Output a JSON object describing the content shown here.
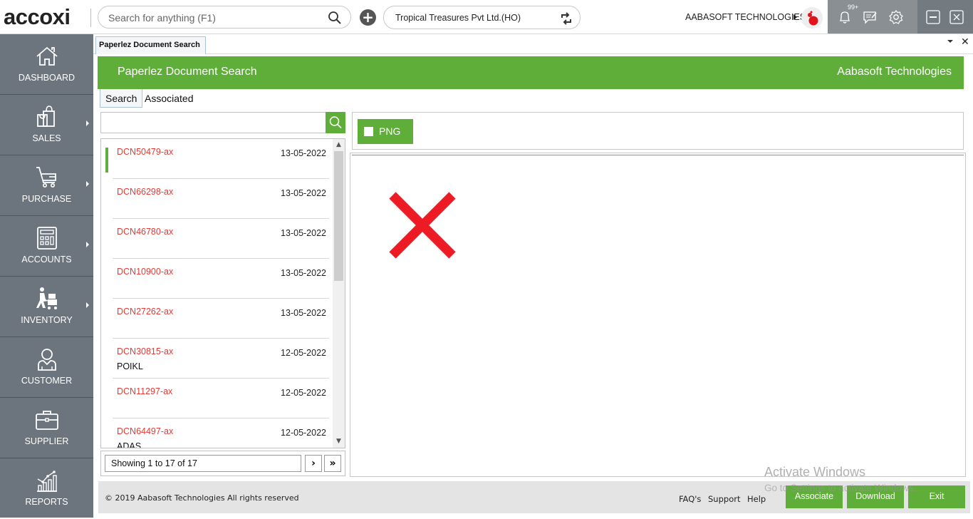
{
  "app": {
    "logo": "accoxi",
    "search_placeholder": "Search for anything (F1)",
    "company": "Tropical Treasures Pvt Ltd.(HO)",
    "organization": "AABASOFT TECHNOLOGIES",
    "notification_count": "99+"
  },
  "sidebar": {
    "items": [
      {
        "label": "DASHBOARD",
        "icon": "home-icon",
        "has_submenu": false
      },
      {
        "label": "SALES",
        "icon": "shopping-bag-icon",
        "has_submenu": true
      },
      {
        "label": "PURCHASE",
        "icon": "cart-icon",
        "has_submenu": true
      },
      {
        "label": "ACCOUNTS",
        "icon": "calculator-icon",
        "has_submenu": true
      },
      {
        "label": "INVENTORY",
        "icon": "inventory-icon",
        "has_submenu": true
      },
      {
        "label": "CUSTOMER",
        "icon": "customer-icon",
        "has_submenu": false
      },
      {
        "label": "SUPPLIER",
        "icon": "briefcase-icon",
        "has_submenu": false
      },
      {
        "label": "REPORTS",
        "icon": "reports-icon",
        "has_submenu": false
      }
    ]
  },
  "doc_tab": {
    "label": "Paperlez Document Search"
  },
  "header": {
    "title": "Paperlez Document Search",
    "organization": "Aabasoft Technologies"
  },
  "subtabs": {
    "search": "Search",
    "associated": "Associated"
  },
  "list_search": {
    "value": "",
    "placeholder": ""
  },
  "documents": [
    {
      "code": "DCN50479-ax",
      "date": "13-05-2022",
      "note": "",
      "selected": true
    },
    {
      "code": "DCN66298-ax",
      "date": "13-05-2022",
      "note": "",
      "selected": false
    },
    {
      "code": "DCN46780-ax",
      "date": "13-05-2022",
      "note": "",
      "selected": false
    },
    {
      "code": "DCN10900-ax",
      "date": "13-05-2022",
      "note": "",
      "selected": false
    },
    {
      "code": "DCN27262-ax",
      "date": "13-05-2022",
      "note": "",
      "selected": false
    },
    {
      "code": "DCN30815-ax",
      "date": "12-05-2022",
      "note": "POIKL",
      "selected": false
    },
    {
      "code": "DCN11297-ax",
      "date": "12-05-2022",
      "note": "",
      "selected": false
    },
    {
      "code": "DCN64497-ax",
      "date": "12-05-2022",
      "note": "ADAS",
      "selected": false
    }
  ],
  "pager": {
    "info": "Showing 1 to 17 of 17",
    "next": "›",
    "last": "»"
  },
  "viewer": {
    "file_type_label": "PNG",
    "file_type_checked": false,
    "preview_state": "unavailable"
  },
  "footer": {
    "copyright": "© 2019 Aabasoft Technologies All rights reserved",
    "links": [
      "FAQ's",
      "Support",
      "Help"
    ],
    "buttons": {
      "associate": "Associate",
      "download": "Download",
      "exit": "Exit"
    }
  },
  "watermark": {
    "line1": "Activate Windows",
    "line2": "Go to Settings to activate Windows."
  },
  "colors": {
    "accent": "#5fae3a",
    "sidebar": "#6c757d",
    "doc_code": "#e53935",
    "error_x": "#ed1c24"
  }
}
